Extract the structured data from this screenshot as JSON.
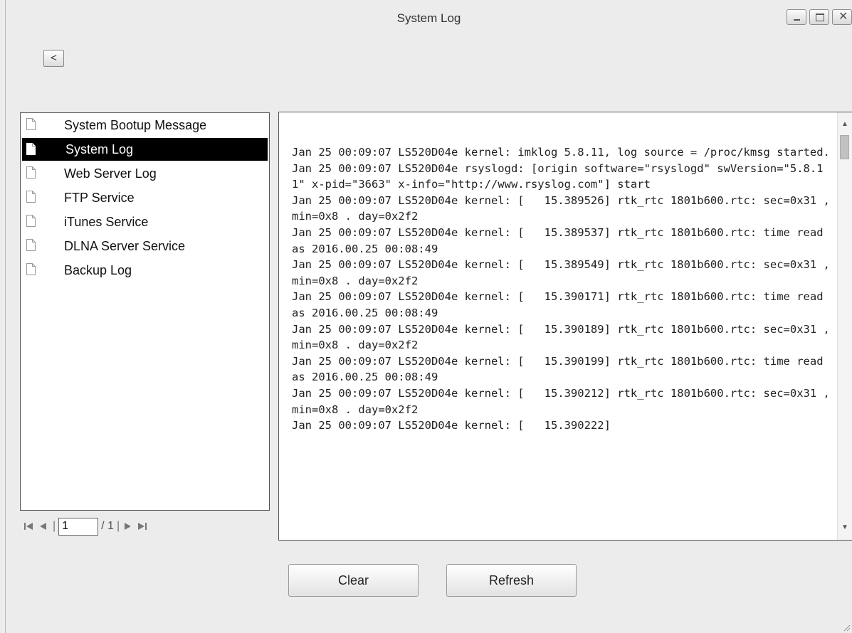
{
  "window": {
    "title": "System Log",
    "controls": {
      "minimize": "minimize-icon",
      "maximize": "maximize-icon",
      "close": "close-icon"
    }
  },
  "back_button": {
    "label": "<"
  },
  "log_list": {
    "items": [
      {
        "label": "System Bootup Message",
        "selected": false
      },
      {
        "label": "System Log",
        "selected": true
      },
      {
        "label": "Web Server Log",
        "selected": false
      },
      {
        "label": "FTP Service",
        "selected": false
      },
      {
        "label": "iTunes Service",
        "selected": false
      },
      {
        "label": "DLNA Server Service",
        "selected": false
      },
      {
        "label": "Backup Log",
        "selected": false
      }
    ]
  },
  "pager": {
    "current_page": "1",
    "total_label": "/ 1"
  },
  "log": {
    "text": "Jan 25 00:09:07 LS520D04e kernel: imklog 5.8.11, log source = /proc/kmsg started.\nJan 25 00:09:07 LS520D04e rsyslogd: [origin software=\"rsyslogd\" swVersion=\"5.8.11\" x-pid=\"3663\" x-info=\"http://www.rsyslog.com\"] start\nJan 25 00:09:07 LS520D04e kernel: [   15.389526] rtk_rtc 1801b600.rtc: sec=0x31 , min=0x8 . day=0x2f2\nJan 25 00:09:07 LS520D04e kernel: [   15.389537] rtk_rtc 1801b600.rtc: time read as 2016.00.25 00:08:49\nJan 25 00:09:07 LS520D04e kernel: [   15.389549] rtk_rtc 1801b600.rtc: sec=0x31 , min=0x8 . day=0x2f2\nJan 25 00:09:07 LS520D04e kernel: [   15.390171] rtk_rtc 1801b600.rtc: time read as 2016.00.25 00:08:49\nJan 25 00:09:07 LS520D04e kernel: [   15.390189] rtk_rtc 1801b600.rtc: sec=0x31 , min=0x8 . day=0x2f2\nJan 25 00:09:07 LS520D04e kernel: [   15.390199] rtk_rtc 1801b600.rtc: time read as 2016.00.25 00:08:49\nJan 25 00:09:07 LS520D04e kernel: [   15.390212] rtk_rtc 1801b600.rtc: sec=0x31 , min=0x8 . day=0x2f2\nJan 25 00:09:07 LS520D04e kernel: [   15.390222]"
  },
  "buttons": {
    "clear": "Clear",
    "refresh": "Refresh"
  }
}
